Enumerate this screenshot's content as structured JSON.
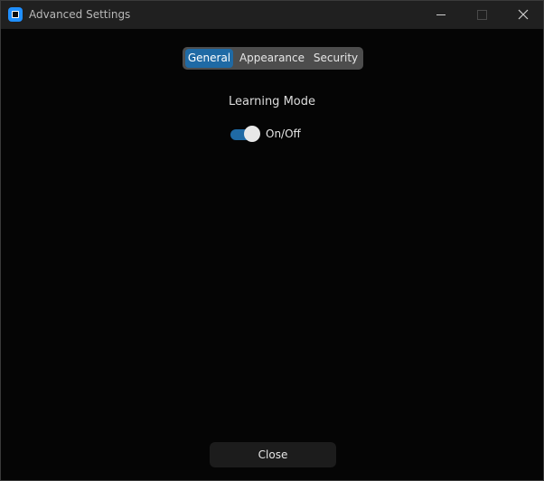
{
  "window": {
    "title": "Advanced Settings"
  },
  "tabs": [
    {
      "label": "General",
      "selected": true
    },
    {
      "label": "Appearance",
      "selected": false
    },
    {
      "label": "Security",
      "selected": false
    }
  ],
  "general": {
    "section_label": "Learning Mode",
    "toggle_label": "On/Off",
    "toggle_on": true
  },
  "footer": {
    "close_label": "Close"
  },
  "colors": {
    "accent": "#1f6aa5",
    "background": "#050505",
    "titlebar": "#202020"
  }
}
